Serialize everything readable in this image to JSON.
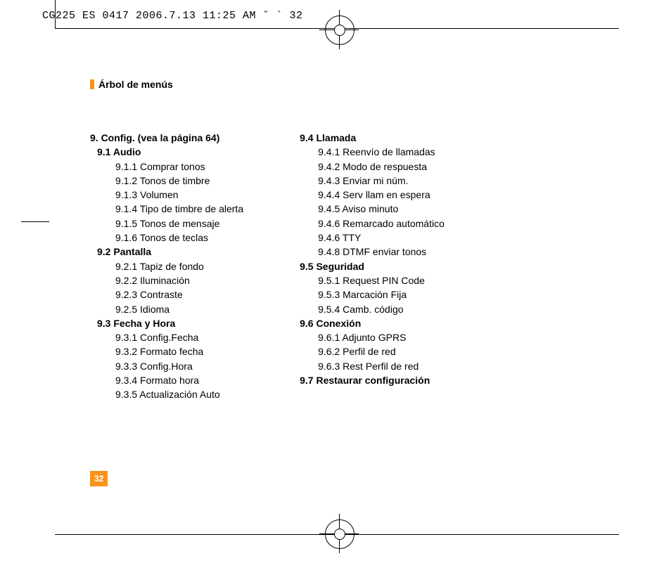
{
  "header": "CG225 ES 0417  2006.7.13 11:25 AM  ˘   ` 32",
  "sectionTitle": "Árbol de menús",
  "pageNumber": "32",
  "colA": {
    "topLevel": "9.  Config. (vea la página 64)",
    "s1": {
      "title": "9.1 Audio",
      "items": [
        "9.1.1 Comprar tonos",
        "9.1.2 Tonos de timbre",
        "9.1.3 Volumen",
        "9.1.4 Tipo de timbre de alerta",
        "9.1.5 Tonos de mensaje",
        "9.1.6 Tonos de teclas"
      ]
    },
    "s2": {
      "title": "9.2 Pantalla",
      "items": [
        "9.2.1 Tapiz de fondo",
        "9.2.2 Iluminación",
        "9.2.3 Contraste",
        "9.2.5 Idioma"
      ]
    },
    "s3": {
      "title": "9.3 Fecha y Hora",
      "items": [
        "9.3.1 Config.Fecha",
        "9.3.2 Formato fecha",
        "9.3.3 Config.Hora",
        "9.3.4 Formato hora",
        "9.3.5 Actualización Auto"
      ]
    }
  },
  "colB": {
    "s4": {
      "title": "9.4 Llamada",
      "items": [
        "9.4.1 Reenvío de llamadas",
        "9.4.2 Modo de respuesta",
        "9.4.3 Enviar mi núm.",
        "9.4.4 Serv llam en espera",
        "9.4.5 Aviso minuto",
        "9.4.6 Remarcado automático",
        "9.4.6 TTY",
        "9.4.8 DTMF enviar tonos"
      ]
    },
    "s5": {
      "title": "9.5 Seguridad",
      "items": [
        "9.5.1 Request PIN Code",
        "9.5.3 Marcación Fija",
        "9.5.4 Camb. código"
      ]
    },
    "s6": {
      "title": "9.6 Conexión",
      "items": [
        "9.6.1 Adjunto GPRS",
        "9.6.2 Perfil de red",
        "9.6.3 Rest Perfil de red"
      ]
    },
    "s7": {
      "title": "9.7 Restaurar configuración"
    }
  }
}
